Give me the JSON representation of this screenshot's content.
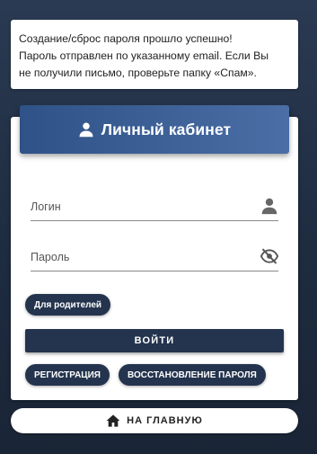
{
  "notice": {
    "lines": [
      "Создание/сброс пароля прошло успешно!",
      "Пароль отправлен по указанному email. Если Вы",
      "не получили письмо, проверьте папку «Спам»."
    ]
  },
  "card": {
    "title": "Личный кабинет",
    "title_icon": "user-icon"
  },
  "form": {
    "login": {
      "placeholder": "Логин",
      "value": "",
      "icon": "user-icon"
    },
    "password": {
      "placeholder": "Пароль",
      "value": "",
      "icon": "eye-off-icon"
    },
    "parents_label": "Для родителей",
    "submit_label": "ВОЙТИ",
    "register_label": "РЕГИСТРАЦИЯ",
    "restore_label": "ВОССТАНОВЛЕНИЕ ПАРОЛЯ"
  },
  "home": {
    "label": "НА ГЛАВНУЮ",
    "icon": "home-icon"
  },
  "colors": {
    "background": "#1e2c40",
    "header_start": "#2f5288",
    "header_end": "#4a6ea5",
    "button": "#24344e"
  }
}
